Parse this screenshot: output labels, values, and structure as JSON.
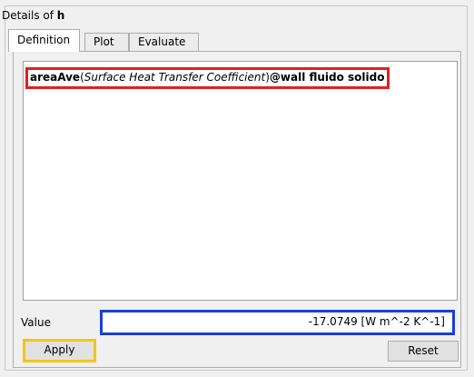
{
  "header": {
    "prefix": "Details of ",
    "object_name": "h"
  },
  "tabs": [
    {
      "label": "Definition",
      "active": true
    },
    {
      "label": "Plot",
      "active": false
    },
    {
      "label": "Evaluate",
      "active": false
    }
  ],
  "expression": {
    "function": "areaAve",
    "open_paren": "(",
    "argument": "Surface Heat Transfer Coefficient",
    "close_paren": ")",
    "location": "@wall fluido solido"
  },
  "value": {
    "label": "Value",
    "text": "-17.0749 [W m^-2 K^-1]"
  },
  "buttons": {
    "apply": "Apply",
    "reset": "Reset"
  },
  "colors": {
    "highlight_expression": "#e02020",
    "highlight_value": "#1a3fd6",
    "highlight_apply": "#f5c518"
  }
}
